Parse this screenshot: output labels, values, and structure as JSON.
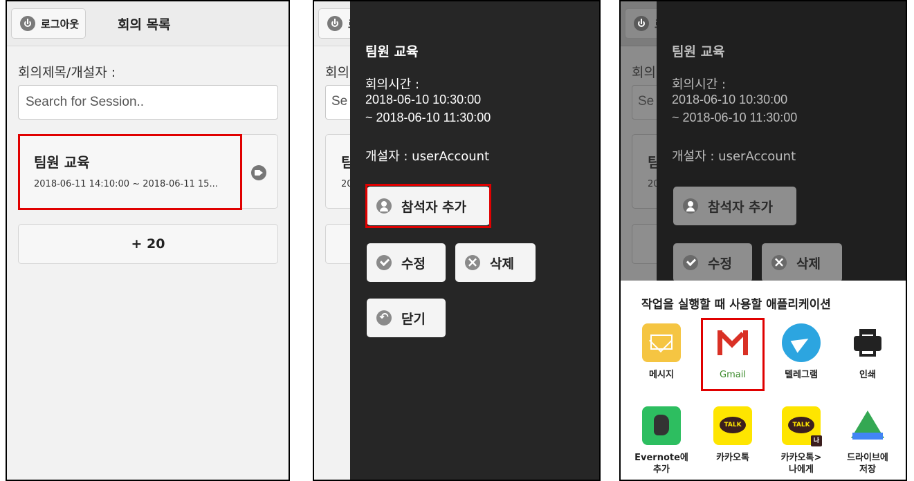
{
  "list_screen": {
    "logout_label": "로그아웃",
    "title": "회의 목록",
    "search_label": "회의제목/개설자 :",
    "search_placeholder": "Search for Session..",
    "session": {
      "title": "팀원 교육",
      "time": "2018-06-11 14:10:00 ~ 2018-06-11 15..."
    },
    "more_label": "+ 20"
  },
  "peek": {
    "logout_fragment": "로",
    "label_fragment": "회의",
    "search_fragment": "Se",
    "card_fragment": "팀",
    "time_fragment": "20"
  },
  "detail_screen": {
    "title": "팀원 교육",
    "time_label": "회의시간 :",
    "start": "2018-06-10 10:30:00",
    "end": "~ 2018-06-10 11:30:00",
    "owner": "개설자 : userAccount",
    "add_participant_label": "참석자 추가",
    "edit_label": "수정",
    "delete_label": "삭제",
    "close_label": "닫기"
  },
  "share_sheet": {
    "title": "작업을 실행할 때 사용할 애플리케이션",
    "apps": [
      {
        "label": "메시지",
        "icon": "message-icon"
      },
      {
        "label": "Gmail",
        "icon": "gmail-icon"
      },
      {
        "label": "텔레그램",
        "icon": "telegram-icon"
      },
      {
        "label": "인쇄",
        "icon": "print-icon"
      },
      {
        "label_line1": "Evernote에",
        "label_line2": "추가",
        "icon": "evernote-icon"
      },
      {
        "label": "카카오톡",
        "icon": "kakaotalk-icon"
      },
      {
        "label_line1": "카카오톡>",
        "label_line2": "나에게",
        "icon": "kakaotalk-me-icon"
      },
      {
        "label_line1": "드라이브에",
        "label_line2": "저장",
        "icon": "drive-icon"
      }
    ]
  },
  "colors": {
    "highlight": "#e00000",
    "drawer_bg": "#262626",
    "page_bg": "#f2f2f2"
  }
}
